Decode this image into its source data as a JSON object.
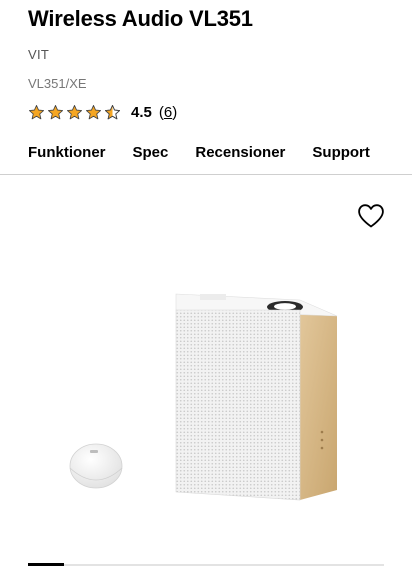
{
  "product": {
    "title": "Wireless Audio VL351",
    "color": "VIT",
    "model": "VL351/XE"
  },
  "rating": {
    "value": "4.5",
    "score": 4.5,
    "max": 5,
    "open_paren": "(",
    "count": "6",
    "close_paren": ")",
    "star_color": "#f5a623"
  },
  "tabs": [
    {
      "label": "Funktioner"
    },
    {
      "label": "Spec"
    },
    {
      "label": "Recensioner"
    },
    {
      "label": "Support"
    }
  ],
  "wishlist": {
    "icon": "heart-outline-icon"
  },
  "gallery": {
    "image": "wireless-speaker-with-remote",
    "progress": 0.1
  }
}
